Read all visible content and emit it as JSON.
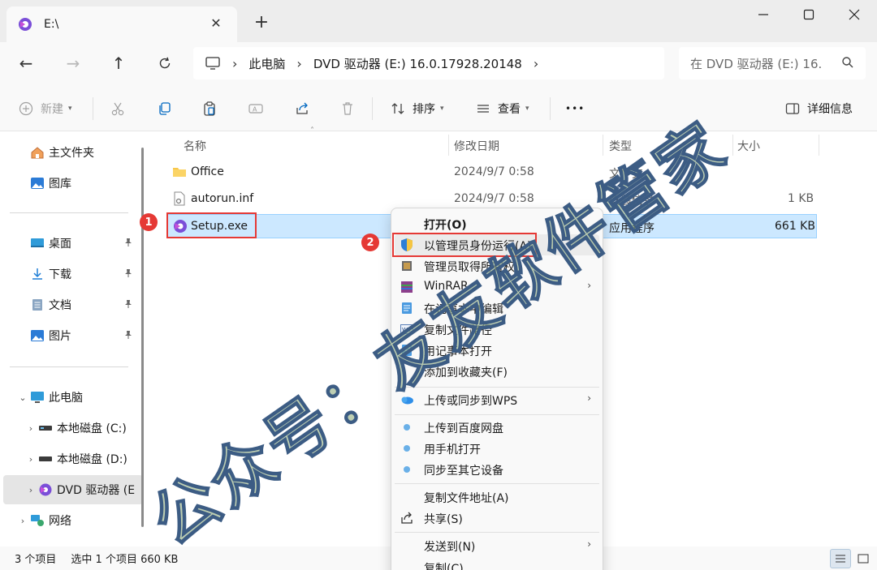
{
  "window": {
    "tab_title": "E:\\",
    "close_tab_glyph": "✕",
    "new_tab_glyph": "+",
    "controls": [
      "minimize-icon",
      "maximize-icon",
      "close-icon"
    ]
  },
  "address": {
    "breadcrumbs": [
      "此电脑",
      "DVD 驱动器 (E:) 16.0.17928.20148"
    ],
    "search_placeholder": "在 DVD 驱动器 (E:) 16."
  },
  "toolbar": {
    "new_label": "新建",
    "sort_label": "排序",
    "view_label": "查看",
    "more_label": "•••",
    "details_label": "详细信息",
    "icons": [
      "cut-icon",
      "copy-icon",
      "paste-icon",
      "rename-icon",
      "share-icon",
      "delete-icon"
    ]
  },
  "sidebar": {
    "items": [
      {
        "label": "主文件夹",
        "icon": "home-icon"
      },
      {
        "label": "图库",
        "icon": "gallery-icon"
      },
      {
        "label": "桌面",
        "icon": "desktop-icon",
        "pinned": true
      },
      {
        "label": "下载",
        "icon": "download-icon",
        "pinned": true
      },
      {
        "label": "文档",
        "icon": "documents-icon",
        "pinned": true
      },
      {
        "label": "图片",
        "icon": "pictures-icon",
        "pinned": true
      },
      {
        "label": "此电脑",
        "icon": "computer-icon"
      },
      {
        "label": "本地磁盘 (C:)",
        "icon": "drive-icon"
      },
      {
        "label": "本地磁盘 (D:)",
        "icon": "drive-icon"
      },
      {
        "label": "DVD 驱动器 (E",
        "icon": "dvd-icon"
      },
      {
        "label": "网络",
        "icon": "network-icon"
      }
    ]
  },
  "files": {
    "columns": [
      "名称",
      "修改日期",
      "类型",
      "大小"
    ],
    "rows": [
      {
        "name": "Office",
        "date": "2024/9/7 0:58",
        "type": "文件夹",
        "size": ""
      },
      {
        "name": "autorun.inf",
        "date": "2024/9/7 0:58",
        "type": "安装信息",
        "size": "1 KB"
      },
      {
        "name": "Setup.exe",
        "date": "",
        "type": "应用程序",
        "size": "661 KB"
      }
    ]
  },
  "context_menu": {
    "items": [
      {
        "label": "打开(O)",
        "icon": ""
      },
      {
        "label": "以管理员身份运行(A)",
        "icon": "shield-icon"
      },
      {
        "label": "管理员取得所有权",
        "icon": "key-icon"
      },
      {
        "label": "WinRAR",
        "icon": "winrar-icon",
        "submenu": true
      },
      {
        "label": "在记事本中编辑",
        "icon": "notepad-icon"
      },
      {
        "label": "复制文件路径",
        "icon": "path-icon"
      },
      {
        "label": "用记事本打开",
        "icon": "notepad-icon"
      },
      {
        "label": "添加到收藏夹(F)",
        "icon": ""
      },
      {
        "label": "上传或同步到WPS",
        "icon": "cloud-icon",
        "submenu": true
      },
      {
        "label": "上传到百度网盘",
        "icon": "baidu-icon"
      },
      {
        "label": "用手机打开",
        "icon": "baidu-icon"
      },
      {
        "label": "同步至其它设备",
        "icon": "baidu-icon"
      },
      {
        "label": "复制文件地址(A)",
        "icon": ""
      },
      {
        "label": "共享(S)",
        "icon": "share-icon"
      },
      {
        "label": "发送到(N)",
        "icon": "",
        "submenu": true
      },
      {
        "label": "复制(C)",
        "icon": ""
      }
    ],
    "submenu_glyph": "›"
  },
  "status": {
    "item_count": "3 个项目",
    "selection": "选中 1 个项目  660 KB"
  },
  "annotations": {
    "badge1": "1",
    "badge2": "2"
  },
  "watermark": "公众号：友友软件管家",
  "colors": {
    "accent": "#0067c0",
    "selection_bg": "#cce8ff",
    "annotation_red": "#e53935",
    "folder_yellow": "#f8c74a"
  }
}
